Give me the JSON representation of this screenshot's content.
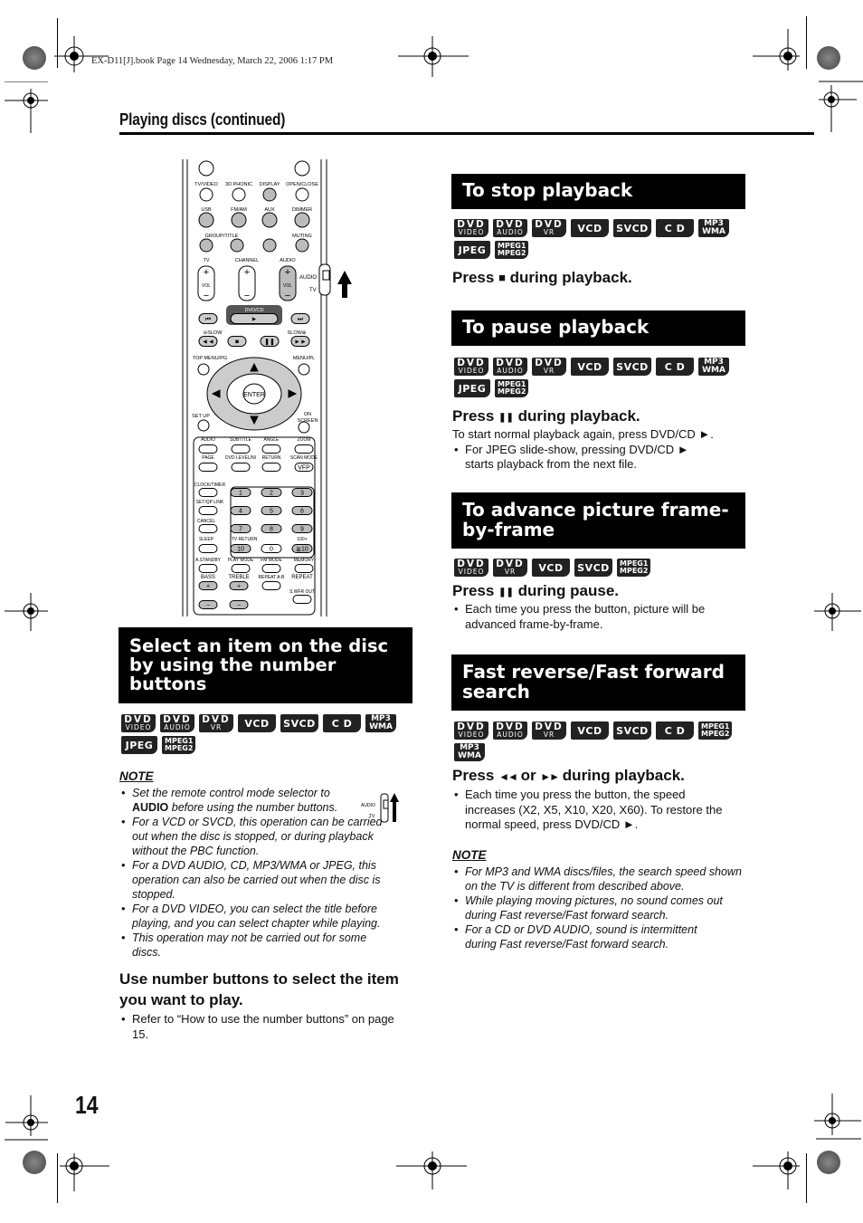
{
  "book_info": "EX-D11[J].book  Page 14  Wednesday, March 22, 2006  1:17 PM",
  "section_header": "Playing discs (continued)",
  "page_number": "14",
  "badge_defs": {
    "dvd_video": {
      "top": "DVD",
      "bottom": "VIDEO"
    },
    "dvd_audio": {
      "top": "DVD",
      "bottom": "AUDIO"
    },
    "dvd_vr": {
      "top": "DVD",
      "bottom": "VR"
    },
    "vcd": {
      "label": "VCD"
    },
    "svcd": {
      "label": "SVCD"
    },
    "cd": {
      "label": "C D"
    },
    "mp3_wma": {
      "top": "MP3",
      "bottom": "WMA"
    },
    "jpeg": {
      "label": "JPEG"
    },
    "mpeg": {
      "top": "MPEG1",
      "bottom": "MPEG2"
    }
  },
  "remote": {
    "labels": [
      "TV/VIDEO",
      "3D PHONIC",
      "DISPLAY",
      "OPEN/CLOSE",
      "USB",
      "FM/AM",
      "AUX",
      "DIMMER",
      "GROUP/TITLE",
      "MUTING",
      "TV",
      "CHANNEL",
      "AUDIO",
      "VOL",
      "DVD/CD",
      "SLOW",
      "TOP MENU/PG",
      "MENU/PL",
      "ENTER",
      "SET UP",
      "ON SCREEN",
      "AUDIO",
      "SUBTITLE",
      "ANGLE",
      "ZOOM",
      "PAGE",
      "DVD LEVEL/NI",
      "RETURN",
      "SCAN MODE",
      "VFP",
      "CLOCK/TIMER",
      "SET/QP LINK",
      "CANCEL",
      "SLEEP",
      "TV RETURN",
      "100+",
      "A.STANDBY",
      "PLAY MODE",
      "FM MODE",
      "MEMORY",
      "BASS",
      "TREBLE",
      "REPEAT A-B",
      "REPEAT",
      "S.WFR OUT"
    ],
    "numbers": [
      "1",
      "2",
      "3",
      "4",
      "5",
      "6",
      "7",
      "8",
      "9",
      "10",
      "0",
      "≧10"
    ],
    "mode_selector": {
      "top": "AUDIO",
      "bottom": "TV"
    }
  },
  "select_section": {
    "title": "Select an item on the disc by using the number buttons",
    "badges": [
      "dvd_video",
      "dvd_audio",
      "dvd_vr",
      "vcd",
      "svcd",
      "cd",
      "mp3_wma",
      "jpeg",
      "mpeg"
    ],
    "note_title": "NOTE",
    "notes": [
      {
        "pre": "Set the remote control mode selector to ",
        "bold": "AUDIO",
        "post": " before using the number buttons."
      },
      {
        "text": "For a VCD or SVCD, this operation can be carried out when the disc is stopped, or during playback without the PBC function."
      },
      {
        "text": "For a DVD AUDIO, CD, MP3/WMA or JPEG, this operation can also be carried out when the disc is stopped."
      },
      {
        "text": "For a DVD VIDEO, you can select the title before playing, and you can select chapter while playing."
      },
      {
        "text": "This operation may not be carried out for some discs."
      }
    ],
    "note_selector": {
      "top": "AUDIO",
      "bottom": "TV"
    },
    "instruction": "Use number buttons to select the item you want to play.",
    "bullets": [
      "Refer to “How to use the number buttons” on page 15."
    ]
  },
  "stop_section": {
    "title": "To stop playback",
    "badges": [
      "dvd_video",
      "dvd_audio",
      "dvd_vr",
      "vcd",
      "svcd",
      "cd",
      "mp3_wma",
      "jpeg",
      "mpeg"
    ],
    "press_pre": "Press",
    "press_symbol": "■",
    "press_post": "during playback."
  },
  "pause_section": {
    "title": "To pause playback",
    "badges": [
      "dvd_video",
      "dvd_audio",
      "dvd_vr",
      "vcd",
      "svcd",
      "cd",
      "mp3_wma",
      "jpeg",
      "mpeg"
    ],
    "press_pre": "Press",
    "press_symbol": "❚❚",
    "press_post": "during playback.",
    "text": "To start normal playback again, press DVD/CD ►.",
    "bullets": [
      "For JPEG slide-show, pressing DVD/CD ► starts playback from the next file."
    ]
  },
  "advance_section": {
    "title": "To advance picture frame-by-frame",
    "badges": [
      "dvd_video",
      "dvd_vr",
      "vcd",
      "svcd",
      "mpeg"
    ],
    "press_pre": "Press",
    "press_symbol": "❚❚",
    "press_post": "during pause.",
    "bullets": [
      "Each time you press the button, picture will be advanced frame-by-frame."
    ]
  },
  "search_section": {
    "title": "Fast reverse/Fast forward search",
    "badges": [
      "dvd_video",
      "dvd_audio",
      "dvd_vr",
      "vcd",
      "svcd",
      "cd",
      "mpeg",
      "mp3_wma"
    ],
    "press_pre": "Press",
    "press_symbol": "◄◄",
    "press_mid": "or",
    "press_symbol2": "►►",
    "press_post": "during playback.",
    "bullets": [
      "Each time you press the button, the speed increases (X2, X5, X10, X20, X60). To restore the normal speed, press DVD/CD ►."
    ],
    "note_title": "NOTE",
    "notes": [
      "For MP3 and WMA discs/files, the search speed shown on the TV is different from described above.",
      "While playing moving pictures, no sound comes out during Fast reverse/Fast forward search.",
      "For a CD or DVD AUDIO, sound is intermittent during Fast reverse/Fast forward search."
    ]
  }
}
